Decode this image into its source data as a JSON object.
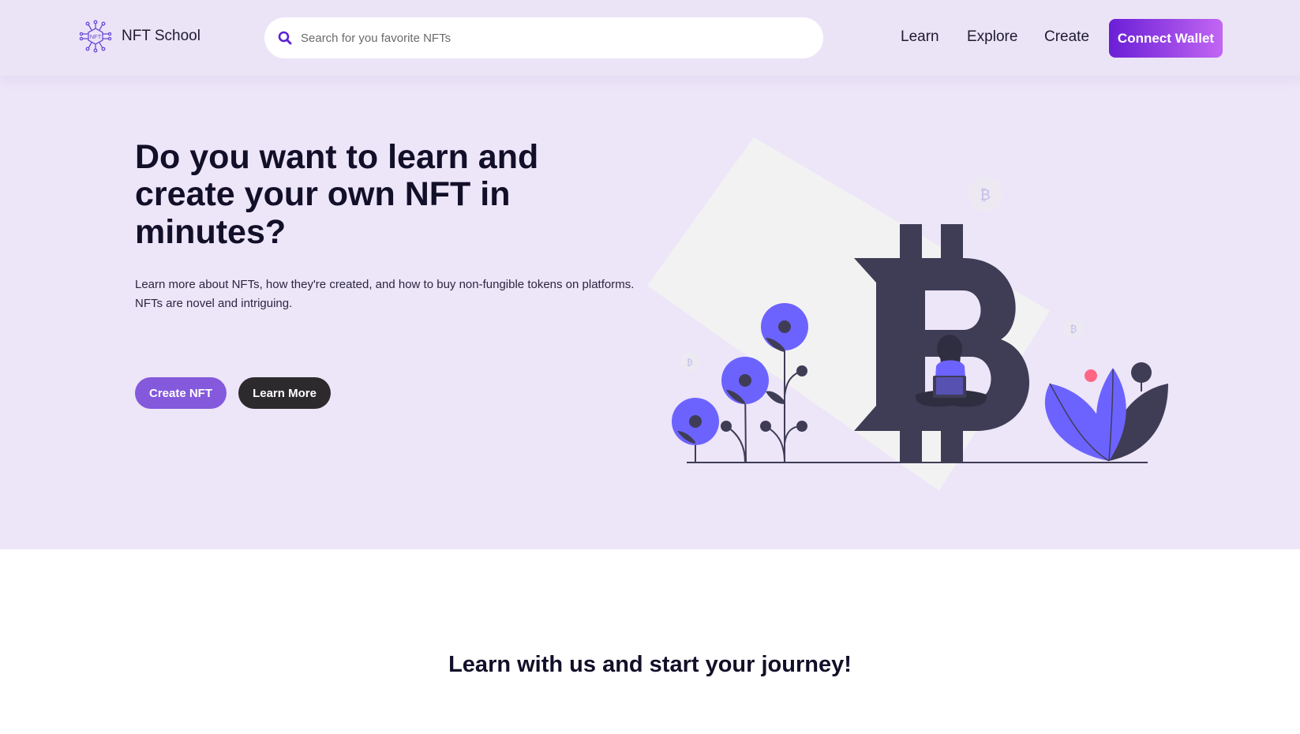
{
  "brand": {
    "name": "NFT School",
    "logo_text": "NFT"
  },
  "search": {
    "placeholder": "Search for you favorite NFTs",
    "value": ""
  },
  "nav": {
    "items": [
      "Learn",
      "Explore",
      "Create"
    ],
    "connect_label": "Connect Wallet"
  },
  "hero": {
    "title": "Do you want to learn and create your own NFT in minutes?",
    "description": "Learn more about NFTs, how they're created, and how to buy non-fungible tokens on platforms. NFTs are novel and intriguing.",
    "primary_button": "Create NFT",
    "secondary_button": "Learn More"
  },
  "section": {
    "title": "Learn with us and start your journey!"
  },
  "icons": {
    "logo": "nft-circuit-logo-icon",
    "search": "search-icon",
    "illustration": "bitcoin-woman-laptop-illustration"
  },
  "colors": {
    "accent": "#6c63ff",
    "button_purple": "#8459dc",
    "button_dark": "#2c2a2d",
    "hero_bg": "#ede5f8",
    "header_bg": "#ebe4f7",
    "connect_start": "#6a1fd6",
    "connect_end": "#c266f3"
  }
}
